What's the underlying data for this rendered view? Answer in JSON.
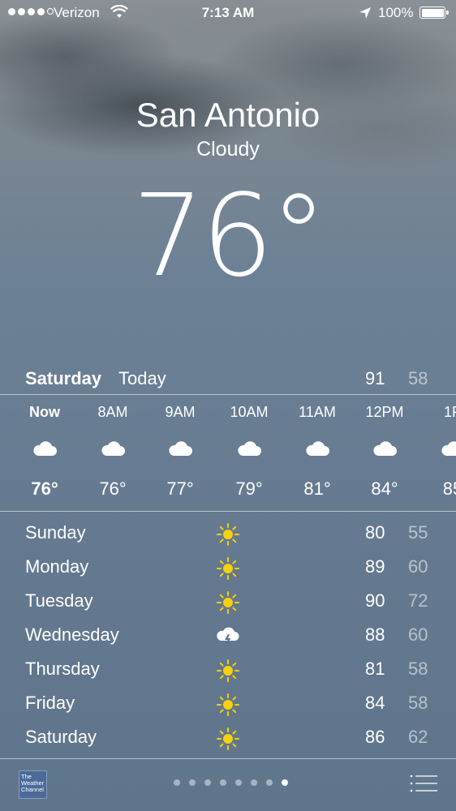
{
  "status_bar": {
    "signal_bars": 4,
    "signal_total": 5,
    "carrier": "Verizon",
    "time": "7:13 AM",
    "battery": "100%"
  },
  "location": {
    "city": "San Antonio",
    "condition": "Cloudy",
    "temperature": "76°"
  },
  "today": {
    "day": "Saturday",
    "label": "Today",
    "high": "91",
    "low": "58"
  },
  "hourly": [
    {
      "time": "Now",
      "temp": "76°",
      "icon": "cloud-icon"
    },
    {
      "time": "8AM",
      "temp": "76°",
      "icon": "cloud-icon"
    },
    {
      "time": "9AM",
      "temp": "77°",
      "icon": "cloud-icon"
    },
    {
      "time": "10AM",
      "temp": "79°",
      "icon": "cloud-icon"
    },
    {
      "time": "11AM",
      "temp": "81°",
      "icon": "cloud-icon"
    },
    {
      "time": "12PM",
      "temp": "84°",
      "icon": "cloud-icon"
    },
    {
      "time": "1P",
      "temp": "85",
      "icon": "cloud-icon"
    }
  ],
  "daily": [
    {
      "day": "Sunday",
      "icon": "sun-icon",
      "high": "80",
      "low": "55"
    },
    {
      "day": "Monday",
      "icon": "sun-icon",
      "high": "89",
      "low": "60"
    },
    {
      "day": "Tuesday",
      "icon": "sun-icon",
      "high": "90",
      "low": "72"
    },
    {
      "day": "Wednesday",
      "icon": "thunderstorm-icon",
      "high": "88",
      "low": "60"
    },
    {
      "day": "Thursday",
      "icon": "sun-icon",
      "high": "81",
      "low": "58"
    },
    {
      "day": "Friday",
      "icon": "sun-icon",
      "high": "84",
      "low": "58"
    },
    {
      "day": "Saturday",
      "icon": "sun-icon",
      "high": "86",
      "low": "62"
    }
  ],
  "footer": {
    "provider_logo_text": "The Weather Channel",
    "page_count": 8,
    "active_page": 8
  },
  "colors": {
    "sun": "#f5d10f",
    "text": "#ffffff",
    "low_temp": "#b8c3cf"
  }
}
